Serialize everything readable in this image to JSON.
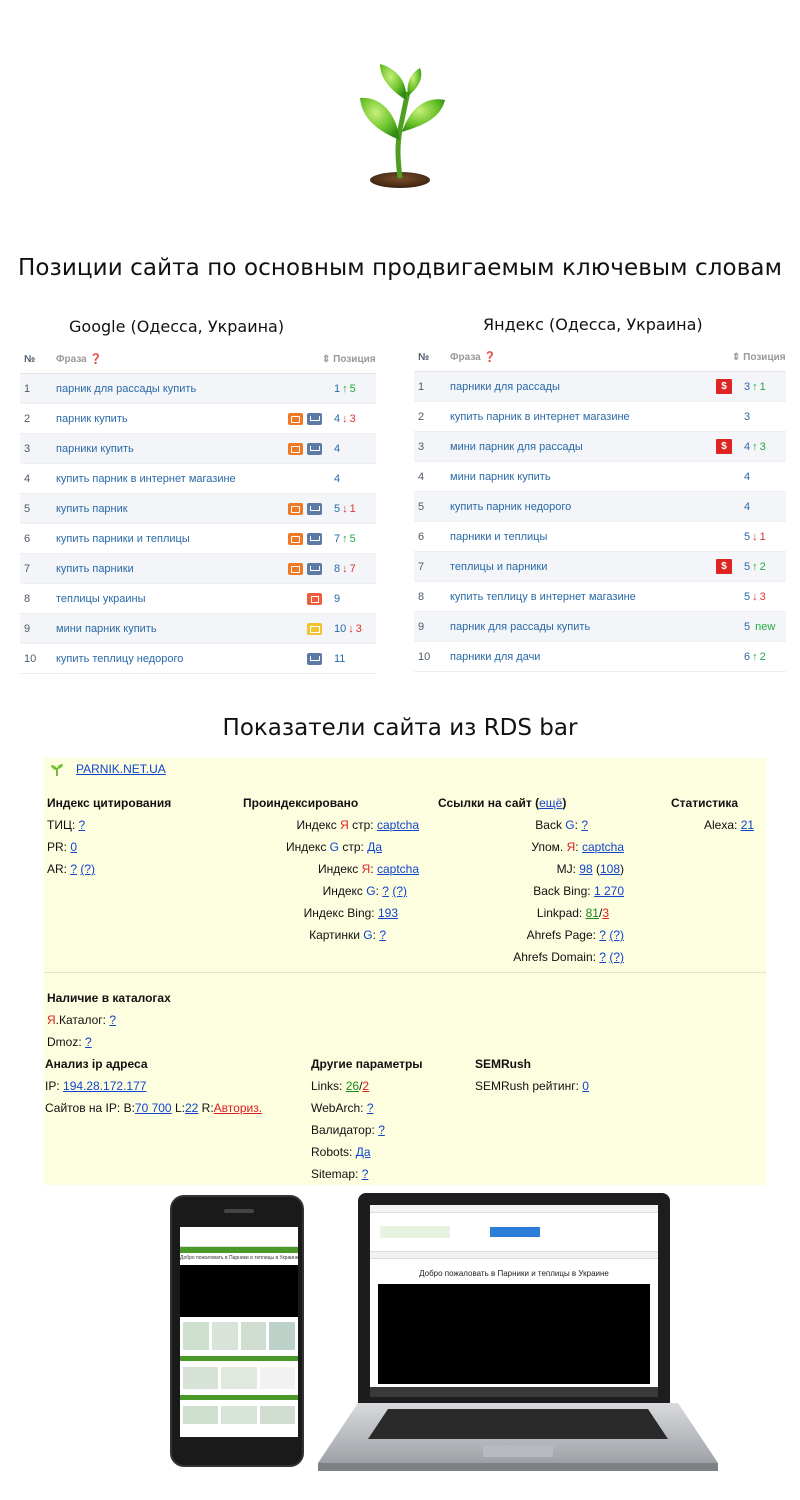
{
  "main_title": "Позиции сайта по основным продвигаемым ключевым словам",
  "google": {
    "title": "Google (Одесса, Украина)",
    "head_num": "№",
    "head_phrase": "Фраза ❓",
    "head_pos": "⇕ Позиция",
    "rows": [
      {
        "n": "1",
        "phrase": "парник для рассады купить",
        "pos": "1",
        "dir": "up",
        "delta": "5"
      },
      {
        "n": "2",
        "phrase": "парник купить",
        "pos": "4",
        "dir": "down",
        "delta": "3"
      },
      {
        "n": "3",
        "phrase": "парники купить",
        "pos": "4",
        "dir": "",
        "delta": ""
      },
      {
        "n": "4",
        "phrase": "купить парник в интернет магазине",
        "pos": "4",
        "dir": "",
        "delta": ""
      },
      {
        "n": "5",
        "phrase": "купить парник",
        "pos": "5",
        "dir": "down",
        "delta": "1"
      },
      {
        "n": "6",
        "phrase": "купить парники и теплицы",
        "pos": "7",
        "dir": "up",
        "delta": "5"
      },
      {
        "n": "7",
        "phrase": "купить парники",
        "pos": "8",
        "dir": "down",
        "delta": "7"
      },
      {
        "n": "8",
        "phrase": "теплицы украины",
        "pos": "9",
        "dir": "",
        "delta": ""
      },
      {
        "n": "9",
        "phrase": "мини парник купить",
        "pos": "10",
        "dir": "down",
        "delta": "3"
      },
      {
        "n": "10",
        "phrase": "купить теплицу недорого",
        "pos": "11",
        "dir": "",
        "delta": ""
      }
    ]
  },
  "yandex": {
    "title": "Яндекс (Одесса, Украина)",
    "head_num": "№",
    "head_phrase": "Фраза ❓",
    "head_pos": "⇕ Позиция",
    "rows": [
      {
        "n": "1",
        "phrase": "парники для рассады",
        "pos": "3",
        "dir": "up",
        "delta": "1"
      },
      {
        "n": "2",
        "phrase": "купить парник в интернет магазине",
        "pos": "3",
        "dir": "",
        "delta": ""
      },
      {
        "n": "3",
        "phrase": "мини парник для рассады",
        "pos": "4",
        "dir": "up",
        "delta": "3"
      },
      {
        "n": "4",
        "phrase": "мини парник купить",
        "pos": "4",
        "dir": "",
        "delta": ""
      },
      {
        "n": "5",
        "phrase": "купить парник недорого",
        "pos": "4",
        "dir": "",
        "delta": ""
      },
      {
        "n": "6",
        "phrase": "парники и теплицы",
        "pos": "5",
        "dir": "down",
        "delta": "1"
      },
      {
        "n": "7",
        "phrase": "теплицы и парники",
        "pos": "5",
        "dir": "up",
        "delta": "2"
      },
      {
        "n": "8",
        "phrase": "купить теплицу в интернет магазине",
        "pos": "5",
        "dir": "down",
        "delta": "3"
      },
      {
        "n": "9",
        "phrase": "парник для рассады купить",
        "pos": "5",
        "dir": "new",
        "delta": "new"
      },
      {
        "n": "10",
        "phrase": "парники для дачи",
        "pos": "6",
        "dir": "up",
        "delta": "2"
      }
    ],
    "dollar_label": "$"
  },
  "rds_title": "Показатели сайта из RDS bar",
  "rds": {
    "site": "PARNIK.NET.UA",
    "citation": {
      "title": "Индекс цитирования",
      "tic_label": "ТИЦ:",
      "tic_val": "?",
      "pr_label": "PR:",
      "pr_val": "0",
      "ar_label": "AR:",
      "ar_val": "?",
      "ar_extra": "(?)"
    },
    "indexed": {
      "title": "Проиндексировано",
      "ya_pages_a": "Индекс ",
      "ya_pages_y": "Я",
      "ya_pages_b": " стр:",
      "ya_pages_val": "captcha",
      "g_pages_a": "Индекс ",
      "g_pages_g": "G",
      "g_pages_b": " стр:",
      "g_pages_val": "Да",
      "ya_idx_a": "Индекс ",
      "ya_idx_y": "Я",
      "ya_idx_b": ":",
      "ya_idx_val": "captcha",
      "g_idx_a": "Индекс ",
      "g_idx_g": "G",
      "g_idx_b": ":",
      "g_idx_val": "?",
      "g_idx_extra": "(?)",
      "bing_label": "Индекс Bing:",
      "bing_val": "193",
      "img_a": "Картинки ",
      "img_g": "G",
      "img_b": ":",
      "img_val": "?"
    },
    "links": {
      "title_a": "Ссылки на сайт (",
      "title_more": "ещё",
      "title_b": ")",
      "backg_a": "Back ",
      "backg_g": "G",
      "backg_b": ":",
      "backg_val": "?",
      "upom_a": "Упом. ",
      "upom_y": "Я",
      "upom_b": ":",
      "upom_val": "captcha",
      "mj_label": "MJ:",
      "mj_val": "98",
      "mj_extra": "108",
      "bing_label": "Back Bing:",
      "bing_val": "1 270",
      "linkpad_label": "Linkpad:",
      "linkpad_a": "81",
      "linkpad_b": "3",
      "ahp_label": "Ahrefs Page:",
      "ahp_val": "?",
      "ahp_extra": "(?)",
      "ahd_label": "Ahrefs Domain:",
      "ahd_val": "?",
      "ahd_extra": "(?)"
    },
    "stats": {
      "title": "Статистика",
      "alexa_label": "Alexa:",
      "alexa_val": "21"
    },
    "catalogs": {
      "title": "Наличие в каталогах",
      "ya_y": "Я",
      "ya_label": ".Каталог:",
      "ya_val": "?",
      "dmoz_label": "Dmoz:",
      "dmoz_val": "?"
    },
    "ip": {
      "title": "Анализ ip адреса",
      "ip_label": "IP:",
      "ip_val": "194.28.172.177",
      "sites_label": "Сайтов на IP: B:",
      "sites_b": "70 700",
      "sites_l_label": "L:",
      "sites_l": "22",
      "sites_r_label": "R:",
      "sites_r": "Авториз."
    },
    "other": {
      "title": "Другие параметры",
      "links_label": "Links:",
      "links_a": "26",
      "links_b": "2",
      "webarch_label": "WebArch:",
      "webarch_val": "?",
      "valid_label": "Валидатор:",
      "valid_val": "?",
      "robots_label": "Robots:",
      "robots_val": "Да",
      "sitemap_label": "Sitemap:",
      "sitemap_val": "?"
    },
    "semrush": {
      "title": "SEMRush",
      "rating_label": "SEMRush рейтинг:",
      "rating_val": "0"
    }
  },
  "devices": {
    "welcome": "Добро пожаловать в Парники и теплицы в Украине"
  }
}
